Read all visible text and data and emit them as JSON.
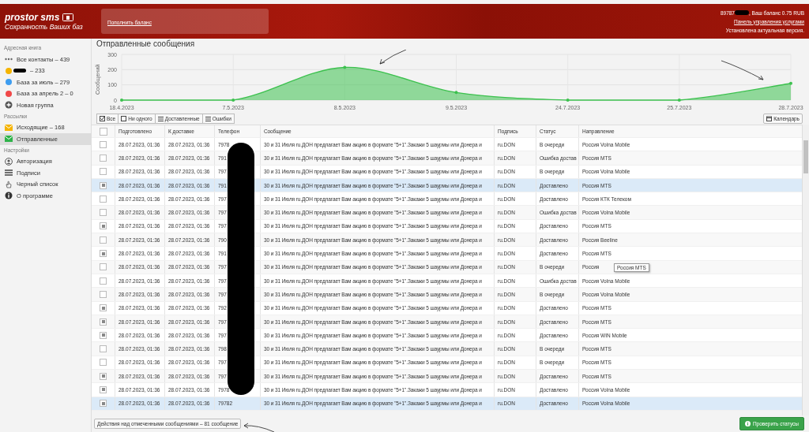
{
  "header": {
    "logo_title": "prostor sms",
    "logo_subtitle": "Сохранность Ваших баз",
    "topup_link": "Пополнить баланс",
    "account": "89787",
    "balance": ", Ваш баланс 0.75 RUB",
    "panel_link": "Панель управления услугами",
    "version_note": "Установлена актуальная версия."
  },
  "sidebar": {
    "sections": [
      {
        "title": "Адресная книга",
        "items": [
          {
            "kind": "dots",
            "label": "Все контакты – 439",
            "selected": false
          },
          {
            "kind": "dot",
            "color": "#f5b400",
            "label": "– 233",
            "redacted": true,
            "selected": false
          },
          {
            "kind": "dot",
            "color": "#3d9df0",
            "label": "База за июль – 279",
            "selected": false
          },
          {
            "kind": "dot",
            "color": "#f04848",
            "label": "База за апрель 2 – 0",
            "selected": false
          },
          {
            "kind": "plus",
            "label": "Новая группа",
            "selected": false
          }
        ]
      },
      {
        "title": "Рассылки",
        "items": [
          {
            "kind": "envelope",
            "color": "#f5b400",
            "label": "Исходящие – 168",
            "selected": false
          },
          {
            "kind": "envelope",
            "color": "#2fb34a",
            "label": "Отправленные",
            "selected": true
          }
        ]
      },
      {
        "title": "Настройки",
        "items": [
          {
            "kind": "user",
            "label": "Авторизация",
            "selected": false
          },
          {
            "kind": "lines",
            "label": "Подписи",
            "selected": false
          },
          {
            "kind": "hand",
            "label": "Черный список",
            "selected": false
          },
          {
            "kind": "info",
            "label": "О программе",
            "selected": false
          }
        ]
      }
    ]
  },
  "page_title": "Отправленные сообщения",
  "chart_data": {
    "type": "area",
    "ylabel": "Сообщений",
    "categories": [
      "18.4.2023",
      "7.5.2023",
      "8.5.2023",
      "9.5.2023",
      "24.7.2023",
      "25.7.2023",
      "28.7.2023"
    ],
    "series": [
      {
        "color": "#3cc14e",
        "values": [
          0,
          0,
          215,
          50,
          0,
          0,
          110
        ]
      }
    ],
    "grid": true,
    "ylim": [
      0,
      300
    ],
    "yticks": [
      0,
      100,
      200,
      300
    ]
  },
  "filters": [
    {
      "kind": "check",
      "label": "Все"
    },
    {
      "kind": "box",
      "label": "Ни одного"
    },
    {
      "kind": "list",
      "label": "Доставленные"
    },
    {
      "kind": "list",
      "label": "Ошибки"
    }
  ],
  "calendar_button": "Календарь",
  "table": {
    "columns": [
      "Подготовлено",
      "К доставке",
      "Телефон",
      "Сообщение",
      "Подпись",
      "Статус",
      "Направление"
    ],
    "header_checked": false,
    "rows": [
      {
        "checked": false,
        "selected": false,
        "prepared": "28.07.2023, 01:36",
        "delivery": "28.07.2023, 01:36",
        "phone": "7978",
        "message": "30 и 31 Июля ru.ДОН предлагает Вам акцию в формате \"5+1\".Закажи 5 шаурмы или Донера и",
        "signature": "ru.DON",
        "status": "В очереди",
        "direction": "Россия Volna Mobile"
      },
      {
        "checked": false,
        "selected": false,
        "prepared": "28.07.2023, 01:36",
        "delivery": "28.07.2023, 01:36",
        "phone": "791",
        "message": "30 и 31 Июля ru.ДОН предлагает Вам акцию в формате \"5+1\".Закажи 5 шаурмы или Донера и",
        "signature": "ru.DON",
        "status": "Ошибка достав",
        "direction": "Россия MTS"
      },
      {
        "checked": false,
        "selected": false,
        "prepared": "28.07.2023, 01:36",
        "delivery": "28.07.2023, 01:36",
        "phone": "797",
        "message": "30 и 31 Июля ru.ДОН предлагает Вам акцию в формате \"5+1\".Закажи 5 шаурмы или Донера и",
        "signature": "ru.DON",
        "status": "В очереди",
        "direction": "Россия Volna Mobile"
      },
      {
        "checked": true,
        "selected": true,
        "prepared": "28.07.2023, 01:36",
        "delivery": "28.07.2023, 01:36",
        "phone": "791",
        "message": "30 и 31 Июля ru.ДОН предлагает Вам акцию в формате \"5+1\".Закажи 5 шаурмы или Донера и",
        "signature": "ru.DON",
        "status": "Доставлено",
        "direction": "Россия MTS"
      },
      {
        "checked": false,
        "selected": false,
        "prepared": "28.07.2023, 01:36",
        "delivery": "28.07.2023, 01:36",
        "phone": "797",
        "message": "30 и 31 Июля ru.ДОН предлагает Вам акцию в формате \"5+1\".Закажи 5 шаурмы или Донера и",
        "signature": "ru.DON",
        "status": "Доставлено",
        "direction": "Россия КТК Телеком"
      },
      {
        "checked": false,
        "selected": false,
        "prepared": "28.07.2023, 01:36",
        "delivery": "28.07.2023, 01:36",
        "phone": "797",
        "message": "30 и 31 Июля ru.ДОН предлагает Вам акцию в формате \"5+1\".Закажи 5 шаурмы или Донера и",
        "signature": "ru.DON",
        "status": "Ошибка достав",
        "direction": "Россия Volna Mobile"
      },
      {
        "checked": true,
        "selected": false,
        "prepared": "28.07.2023, 01:36",
        "delivery": "28.07.2023, 01:36",
        "phone": "797",
        "message": "30 и 31 Июля ru.ДОН предлагает Вам акцию в формате \"5+1\".Закажи 5 шаурмы или Донера и",
        "signature": "ru.DON",
        "status": "Доставлено",
        "direction": "Россия MTS"
      },
      {
        "checked": false,
        "selected": false,
        "prepared": "28.07.2023, 01:36",
        "delivery": "28.07.2023, 01:36",
        "phone": "790",
        "message": "30 и 31 Июля ru.ДОН предлагает Вам акцию в формате \"5+1\".Закажи 5 шаурмы или Донера и",
        "signature": "ru.DON",
        "status": "Доставлено",
        "direction": "Россия Beeline"
      },
      {
        "checked": true,
        "selected": false,
        "prepared": "28.07.2023, 01:36",
        "delivery": "28.07.2023, 01:36",
        "phone": "791",
        "message": "30 и 31 Июля ru.ДОН предлагает Вам акцию в формате \"5+1\".Закажи 5 шаурмы или Донера и",
        "signature": "ru.DON",
        "status": "Доставлено",
        "direction": "Россия MTS"
      },
      {
        "checked": false,
        "selected": false,
        "prepared": "28.07.2023, 01:36",
        "delivery": "28.07.2023, 01:36",
        "phone": "797",
        "message": "30 и 31 Июля ru.ДОН предлагает Вам акцию в формате \"5+1\".Закажи 5 шаурмы или Донера и",
        "signature": "ru.DON",
        "status": "В очереди",
        "direction": "Россия",
        "tooltip": "Россия MTS"
      },
      {
        "checked": false,
        "selected": false,
        "prepared": "28.07.2023, 01:36",
        "delivery": "28.07.2023, 01:36",
        "phone": "797",
        "message": "30 и 31 Июля ru.ДОН предлагает Вам акцию в формате \"5+1\".Закажи 5 шаурмы или Донера и",
        "signature": "ru.DON",
        "status": "Ошибка достав",
        "direction": "Россия Volna Mobile"
      },
      {
        "checked": false,
        "selected": false,
        "prepared": "28.07.2023, 01:36",
        "delivery": "28.07.2023, 01:36",
        "phone": "797",
        "message": "30 и 31 Июля ru.ДОН предлагает Вам акцию в формате \"5+1\".Закажи 5 шаурмы или Донера и",
        "signature": "ru.DON",
        "status": "В очереди",
        "direction": "Россия Volna Mobile"
      },
      {
        "checked": true,
        "selected": false,
        "prepared": "28.07.2023, 01:36",
        "delivery": "28.07.2023, 01:36",
        "phone": "792",
        "message": "30 и 31 Июля ru.ДОН предлагает Вам акцию в формате \"5+1\".Закажи 5 шаурмы или Донера и",
        "signature": "ru.DON",
        "status": "Доставлено",
        "direction": "Россия MTS"
      },
      {
        "checked": true,
        "selected": false,
        "prepared": "28.07.2023, 01:36",
        "delivery": "28.07.2023, 01:36",
        "phone": "797",
        "message": "30 и 31 Июля ru.ДОН предлагает Вам акцию в формате \"5+1\".Закажи 5 шаурмы или Донера и",
        "signature": "ru.DON",
        "status": "Доставлено",
        "direction": "Россия MTS"
      },
      {
        "checked": true,
        "selected": false,
        "prepared": "28.07.2023, 01:36",
        "delivery": "28.07.2023, 01:36",
        "phone": "797",
        "message": "30 и 31 Июля ru.ДОН предлагает Вам акцию в формате \"5+1\".Закажи 5 шаурмы или Донера и",
        "signature": "ru.DON",
        "status": "Доставлено",
        "direction": "Россия WIN Mobile"
      },
      {
        "checked": false,
        "selected": false,
        "prepared": "28.07.2023, 01:36",
        "delivery": "28.07.2023, 01:36",
        "phone": "798",
        "message": "30 и 31 Июля ru.ДОН предлагает Вам акцию в формате \"5+1\".Закажи 5 шаурмы или Донера и",
        "signature": "ru.DON",
        "status": "В очереди",
        "direction": "Россия MTS"
      },
      {
        "checked": false,
        "selected": false,
        "prepared": "28.07.2023, 01:36",
        "delivery": "28.07.2023, 01:36",
        "phone": "797",
        "message": "30 и 31 Июля ru.ДОН предлагает Вам акцию в формате \"5+1\".Закажи 5 шаурмы или Донера и",
        "signature": "ru.DON",
        "status": "В очереди",
        "direction": "Россия MTS"
      },
      {
        "checked": true,
        "selected": false,
        "prepared": "28.07.2023, 01:36",
        "delivery": "28.07.2023, 01:36",
        "phone": "797",
        "message": "30 и 31 Июля ru.ДОН предлагает Вам акцию в формате \"5+1\".Закажи 5 шаурмы или Донера и",
        "signature": "ru.DON",
        "status": "Доставлено",
        "direction": "Россия MTS"
      },
      {
        "checked": true,
        "selected": false,
        "prepared": "28.07.2023, 01:36",
        "delivery": "28.07.2023, 01:36",
        "phone": "7978",
        "message": "30 и 31 Июля ru.ДОН предлагает Вам акцию в формате \"5+1\".Закажи 5 шаурмы или Донера и",
        "signature": "ru.DON",
        "status": "Доставлено",
        "direction": "Россия Volna Mobile"
      },
      {
        "checked": true,
        "selected": true,
        "prepared": "28.07.2023, 01:36",
        "delivery": "28.07.2023, 01:36",
        "phone": "79782",
        "message": "30 и 31 Июля ru.ДОН предлагает Вам акцию в формате \"5+1\".Закажи 5 шаурмы или Донера и",
        "signature": "ru.DON",
        "status": "Доставлено",
        "direction": "Россия Volna Mobile"
      }
    ]
  },
  "actions_button": "Действия над отмеченными сообщениями – 81 сообщение",
  "check_button": "Проверить статусы"
}
